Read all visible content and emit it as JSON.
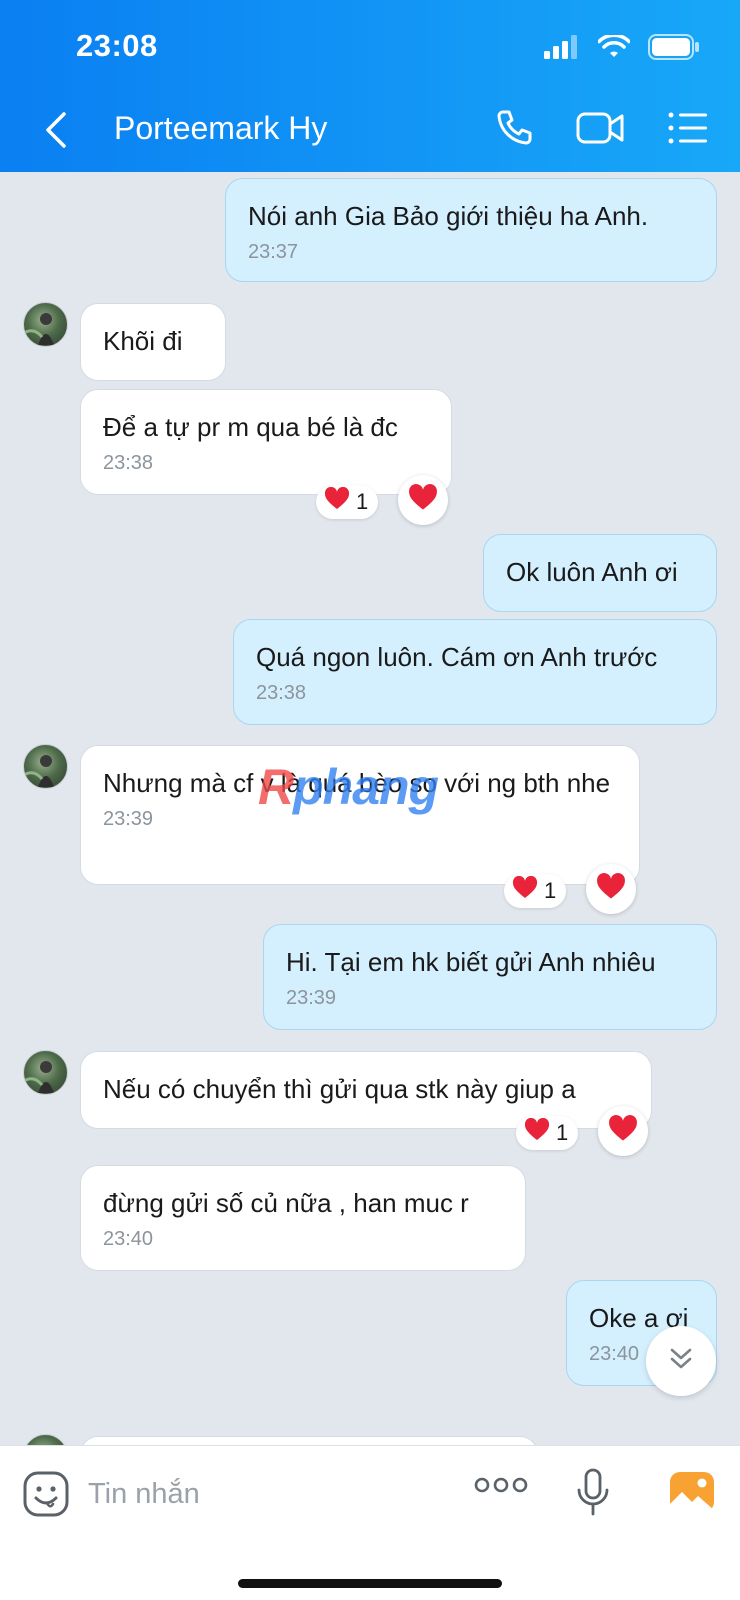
{
  "status_bar": {
    "time": "23:08"
  },
  "header": {
    "title": "Porteemark Hy",
    "icons": [
      "back-chevron-icon",
      "phone-icon",
      "video-call-icon",
      "menu-list-icon"
    ]
  },
  "messages": [
    {
      "dir": "out",
      "text": "Nói anh Gia Bảo giới thiệu ha Anh.",
      "time": "23:37"
    },
    {
      "dir": "in",
      "text": "Khõi đi",
      "time": ""
    },
    {
      "dir": "in",
      "text": "Để a tự pr m qua bé là đc",
      "time": "23:38",
      "reaction_count": "1"
    },
    {
      "dir": "out",
      "text": "Ok luôn Anh ơi",
      "time": ""
    },
    {
      "dir": "out",
      "text": "Quá ngon luôn. Cám ơn Anh trước",
      "time": "23:38"
    },
    {
      "dir": "in",
      "text": "Nhưng mà cf v là quá bèo so với ng bth nhe",
      "time": "23:39",
      "reaction_count": "1"
    },
    {
      "dir": "out",
      "text": "Hi. Tại em hk biết gửi Anh nhiêu",
      "time": "23:39"
    },
    {
      "dir": "in",
      "text": "Nếu có chuyển thì gửi qua stk này giup a",
      "time": "",
      "reaction_count": "1"
    },
    {
      "dir": "in",
      "text": "đừng gửi số củ nữa , han muc r",
      "time": "23:40"
    },
    {
      "dir": "out",
      "text": "Oke a ơi",
      "time": "23:40"
    }
  ],
  "watermark": {
    "part1": "R",
    "part2": "phang"
  },
  "input": {
    "placeholder": "Tin nhắn"
  },
  "colors": {
    "header_start": "#0a7ff2",
    "header_end": "#18a8f8",
    "out_bubble": "#d4effd",
    "in_bubble": "#ffffff",
    "background": "#e2e7ee",
    "reaction_heart": "#e8233a",
    "photo_button": "#f7a233"
  }
}
